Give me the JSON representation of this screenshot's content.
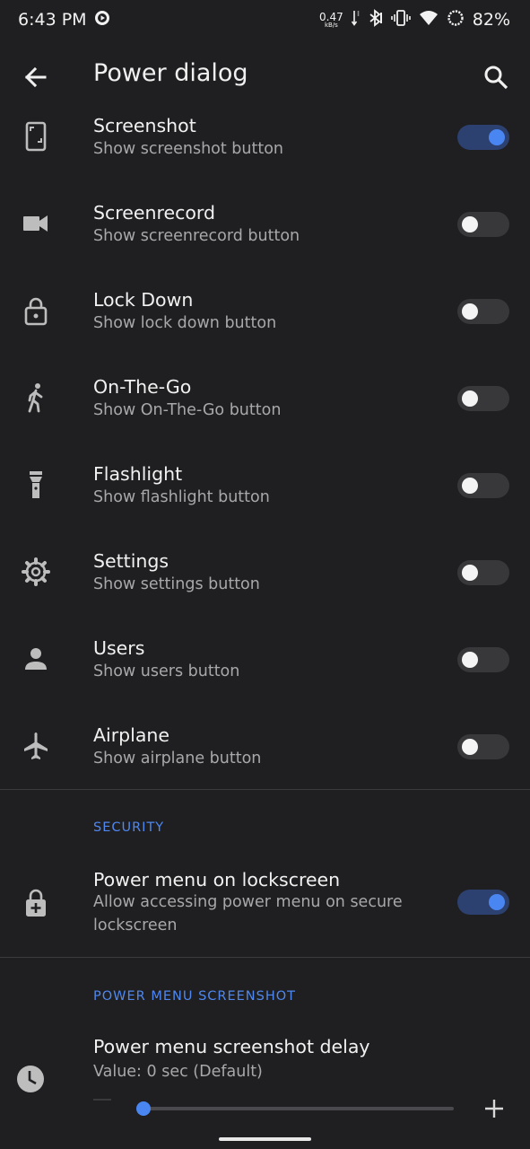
{
  "status_bar": {
    "time": "6:43 PM",
    "speed_value": "0.47",
    "speed_unit": "kB/s",
    "battery": "82%",
    "icons": [
      "media-icon",
      "data-arrows-icon",
      "bluetooth-icon",
      "vibrate-icon",
      "wifi-icon",
      "battery-ring-icon"
    ]
  },
  "app_bar": {
    "title": "Power dialog",
    "back_icon": "arrow-back-icon",
    "search_icon": "search-icon"
  },
  "items": [
    {
      "title": "Screenshot",
      "subtitle": "Show screenshot button",
      "icon": "phone-icon",
      "enabled": true
    },
    {
      "title": "Screenrecord",
      "subtitle": "Show screenrecord button",
      "icon": "videocam-icon",
      "enabled": false
    },
    {
      "title": "Lock Down",
      "subtitle": "Show lock down button",
      "icon": "lock-icon",
      "enabled": false
    },
    {
      "title": "On-The-Go",
      "subtitle": "Show On-The-Go button",
      "icon": "walk-icon",
      "enabled": false
    },
    {
      "title": "Flashlight",
      "subtitle": "Show flashlight button",
      "icon": "flashlight-icon",
      "enabled": false
    },
    {
      "title": "Settings",
      "subtitle": "Show settings button",
      "icon": "gear-icon",
      "enabled": false
    },
    {
      "title": "Users",
      "subtitle": "Show users button",
      "icon": "person-icon",
      "enabled": false
    },
    {
      "title": "Airplane",
      "subtitle": "Show airplane button",
      "icon": "airplane-icon",
      "enabled": false
    }
  ],
  "security": {
    "header": "SECURITY",
    "title": "Power menu on lockscreen",
    "subtitle": "Allow accessing power menu on secure lockscreen",
    "icon": "lock-plus-icon",
    "enabled": true
  },
  "screenshot_section": {
    "header": "POWER MENU SCREENSHOT",
    "title": "Power menu screenshot delay",
    "value": "Value: 0 sec (Default)",
    "icon": "clock-icon",
    "slider_fraction": 0
  },
  "colors": {
    "background": "#1f1f21",
    "accent": "#4a86f2",
    "section_header": "#4f88f0",
    "subtitle": "#a8a8ab"
  }
}
